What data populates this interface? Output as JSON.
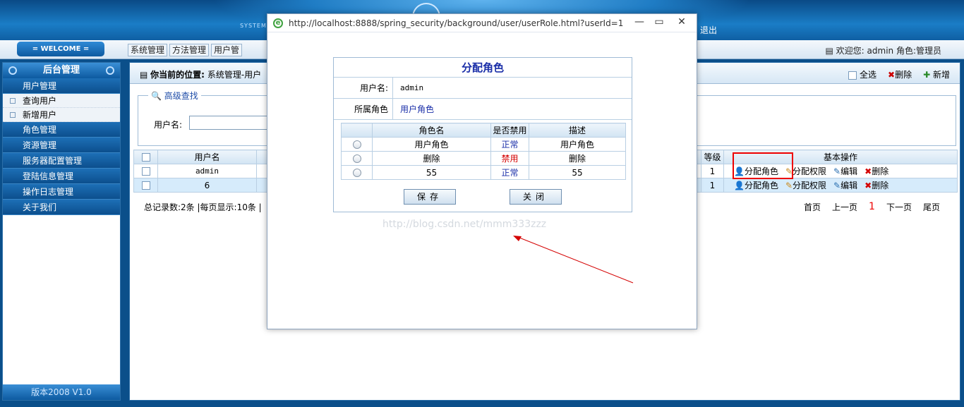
{
  "top": {
    "system_text": "SYSTEM",
    "logout": "退出"
  },
  "nav": {
    "welcome": "= WELCOME =",
    "tabs": [
      "系统管理",
      "方法管理",
      "用户管"
    ],
    "userinfo": "欢迎您: admin 角色:管理员"
  },
  "sidebar": {
    "header": "后台管理",
    "items": [
      {
        "label": "用户管理",
        "type": "menu"
      },
      {
        "label": "查询用户",
        "type": "sub"
      },
      {
        "label": "新增用户",
        "type": "sub"
      },
      {
        "label": "角色管理",
        "type": "menu"
      },
      {
        "label": "资源管理",
        "type": "menu"
      },
      {
        "label": "服务器配置管理",
        "type": "menu"
      },
      {
        "label": "登陆信息管理",
        "type": "menu"
      },
      {
        "label": "操作日志管理",
        "type": "menu"
      },
      {
        "label": "关于我们",
        "type": "menu"
      }
    ],
    "footer": "版本2008 V1.0"
  },
  "main": {
    "crumb_label": "你当前的位置:",
    "crumb_path": "系统管理-用户",
    "actions": {
      "select_all": "全选",
      "delete": "删除",
      "add": "新增"
    },
    "search": {
      "title": "高级查找",
      "label": "用户名:"
    },
    "table": {
      "headers": [
        "",
        "用户名",
        "等级",
        "基本操作"
      ],
      "rows": [
        {
          "username": "admin",
          "level": "1"
        },
        {
          "username": "6",
          "level": "1"
        }
      ],
      "ops": {
        "assign_role": "分配角色",
        "assign_perm": "分配权限",
        "edit": "编辑",
        "delete": "删除"
      }
    },
    "pager": {
      "summary": "总记录数:2条  |每页显示:10条  |",
      "first": "首页",
      "prev": "上一页",
      "current": "1",
      "next": "下一页",
      "last": "尾页"
    }
  },
  "popup": {
    "url": "http://localhost:8888/spring_security/background/user/userRole.html?userId=1",
    "dialog_title": "分配角色",
    "username_label": "用户名:",
    "username_value": "admin",
    "role_label": "所属角色",
    "role_value": "用户角色",
    "role_headers": [
      "",
      "角色名",
      "是否禁用",
      "描述"
    ],
    "roles": [
      {
        "name": "用户角色",
        "status": "正常",
        "status_color": "#1a2ea8",
        "desc": "用户角色"
      },
      {
        "name": "删除",
        "status": "禁用",
        "status_color": "#d40000",
        "desc": "删除"
      },
      {
        "name": "55",
        "status": "正常",
        "status_color": "#1a2ea8",
        "desc": "55"
      }
    ],
    "save": "保存",
    "close": "关闭",
    "watermark": "http://blog.csdn.net/mmm333zzz"
  }
}
